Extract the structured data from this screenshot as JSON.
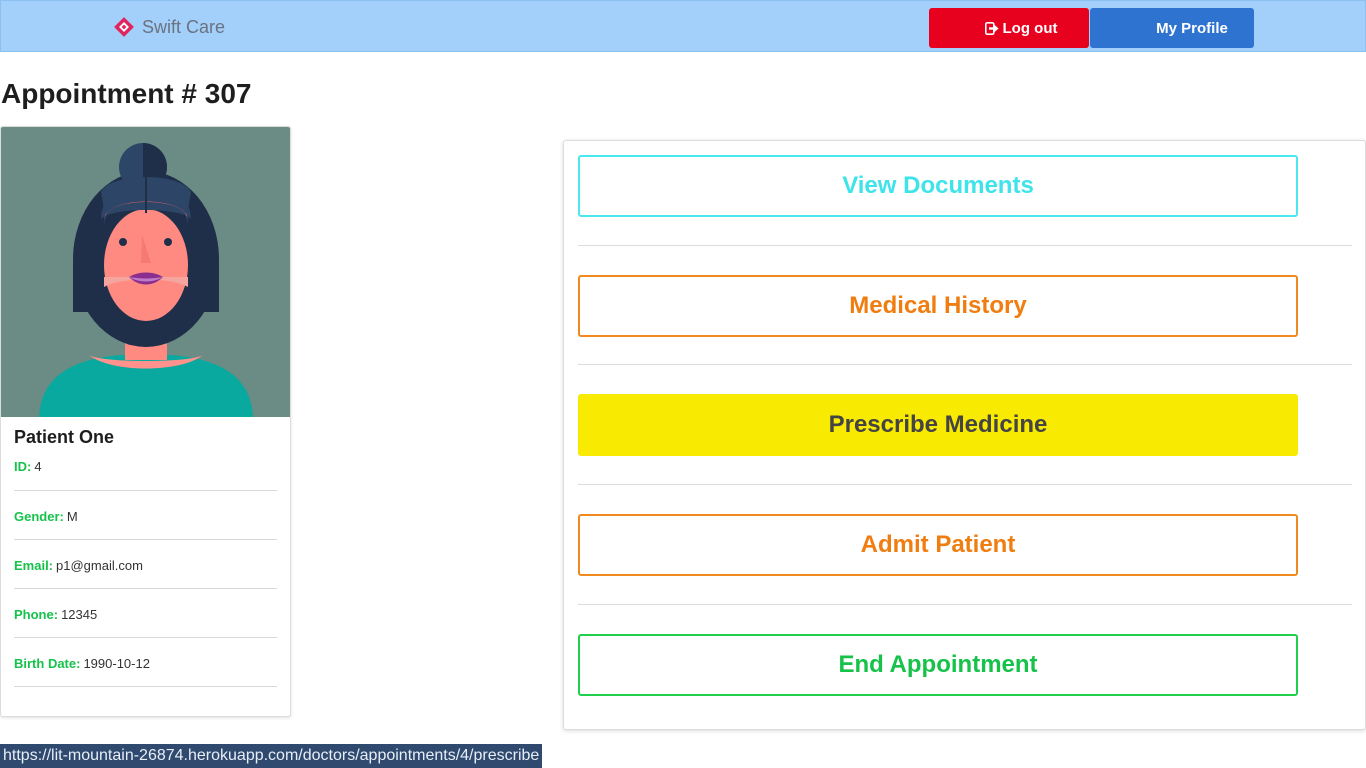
{
  "navbar": {
    "brand": "Swift Care",
    "logout_label": "Log out",
    "profile_label": "My Profile",
    "bg_color": "#a2d0fb"
  },
  "page": {
    "title": "Appointment # 307"
  },
  "patient": {
    "name": "Patient One",
    "fields": [
      {
        "label": "ID:",
        "value": "4"
      },
      {
        "label": "Gender:",
        "value": "M"
      },
      {
        "label": "Email:",
        "value": "p1@gmail.com"
      },
      {
        "label": "Phone:",
        "value": "12345"
      },
      {
        "label": "Birth Date:",
        "value": "1990-10-12"
      }
    ],
    "avatar_icon": "female-avatar-illustration"
  },
  "actions": {
    "view_documents": "View Documents",
    "medical_history": "Medical History",
    "prescribe_medicine": "Prescribe Medicine",
    "admit_patient": "Admit Patient",
    "end_appointment": "End Appointment"
  },
  "status_bar": {
    "url": "https://lit-mountain-26874.herokuapp.com/doctors/appointments/4/prescribe"
  },
  "colors": {
    "logout": "#e8001f",
    "profile": "#2f73d1",
    "label_green": "#16c24a",
    "cyan": "#3fe3ea",
    "orange": "#f07d10",
    "yellow": "#f8ea00"
  }
}
